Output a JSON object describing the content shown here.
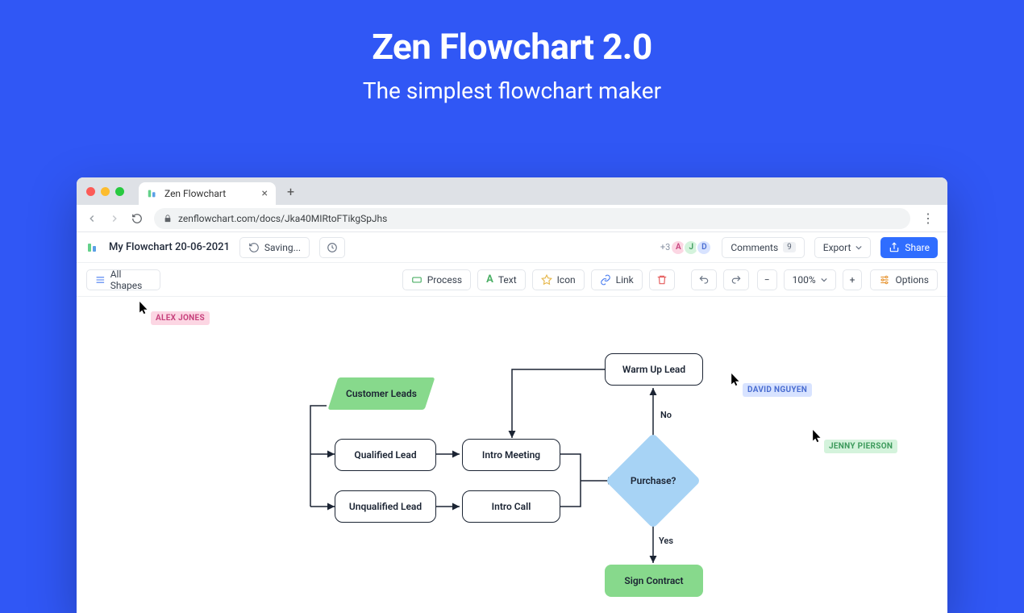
{
  "hero": {
    "title": "Zen Flowchart 2.0",
    "subtitle": "The simplest flowchart maker"
  },
  "browser": {
    "tab_title": "Zen Flowchart",
    "url": "zenflowchart.com/docs/Jka40MIRtoFTikgSpJhs"
  },
  "appbar": {
    "doc_name": "My Flowchart 20-06-2021",
    "saving_label": "Saving...",
    "avatars_more": "+3",
    "avatars": [
      {
        "letter": "A",
        "bg": "#fcd6e3",
        "fg": "#c7427d"
      },
      {
        "letter": "J",
        "bg": "#d4f3dc",
        "fg": "#3d9a5c"
      },
      {
        "letter": "D",
        "bg": "#d8e3ff",
        "fg": "#4a6dd1"
      }
    ],
    "comments_label": "Comments",
    "comments_count": "9",
    "export_label": "Export",
    "share_label": "Share"
  },
  "toolbar": {
    "all_shapes": "All Shapes",
    "process": "Process",
    "text": "Text",
    "icon": "Icon",
    "link": "Link",
    "zoom": "100%",
    "options": "Options"
  },
  "collaborators": {
    "alex": "ALEX JONES",
    "david": "DAVID NGUYEN",
    "jenny": "JENNY PIERSON"
  },
  "flow": {
    "customer_leads": "Customer Leads",
    "qualified": "Qualified Lead",
    "unqualified": "Unqualified Lead",
    "intro_meeting": "Intro Meeting",
    "intro_call": "Intro Call",
    "warm_up": "Warm Up Lead",
    "purchase": "Purchase?",
    "sign_contract": "Sign Contract",
    "no": "No",
    "yes": "Yes"
  }
}
